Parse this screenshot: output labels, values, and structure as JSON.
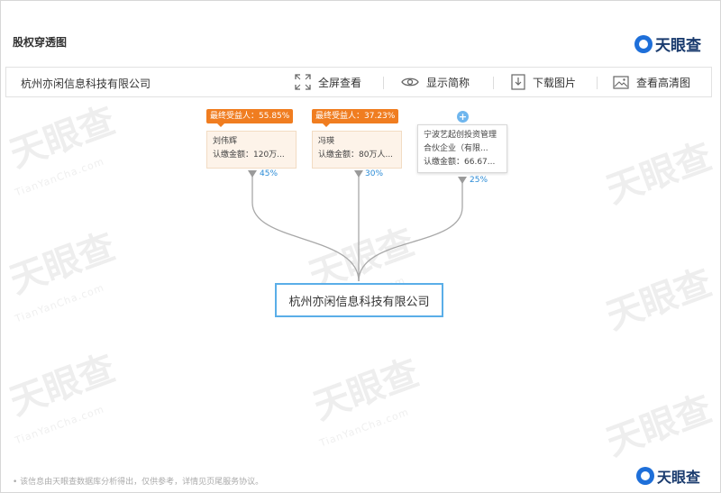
{
  "header": {
    "title": "股权穿透图",
    "logo_text": "天眼查"
  },
  "toolbar": {
    "company": "杭州亦闲信息科技有限公司",
    "fullscreen_label": "全屏查看",
    "short_name_label": "显示简称",
    "download_label": "下载图片",
    "hd_label": "查看高清图"
  },
  "watermark": {
    "text": "天眼查",
    "sub": "TianYanCha.com"
  },
  "diagram": {
    "shareholders": [
      {
        "beneficiary_tag": "最终受益人：55.85%",
        "name": "刘伟辉",
        "amount": "认缴金额：120万...",
        "ratio": "45%"
      },
      {
        "beneficiary_tag": "最终受益人：37.23%",
        "name": "冯瑛",
        "amount": "认缴金额：80万人...",
        "ratio": "30%"
      },
      {
        "name_line1": "宁波艺起创投资管理",
        "name_line2": "合伙企业（有限...",
        "amount": "认缴金额：66.67...",
        "ratio": "25%",
        "expand": "+"
      }
    ],
    "target_company": "杭州亦闲信息科技有限公司"
  },
  "footer": {
    "note": "• 该信息由天眼查数据库分析得出，仅供参考，详情见页尾服务协议。",
    "logo_text": "天眼查"
  },
  "colors": {
    "tag": "#f07d20",
    "link": "#9a9a9a",
    "percent": "#2a8bd6",
    "target_border": "#5aaee8"
  }
}
